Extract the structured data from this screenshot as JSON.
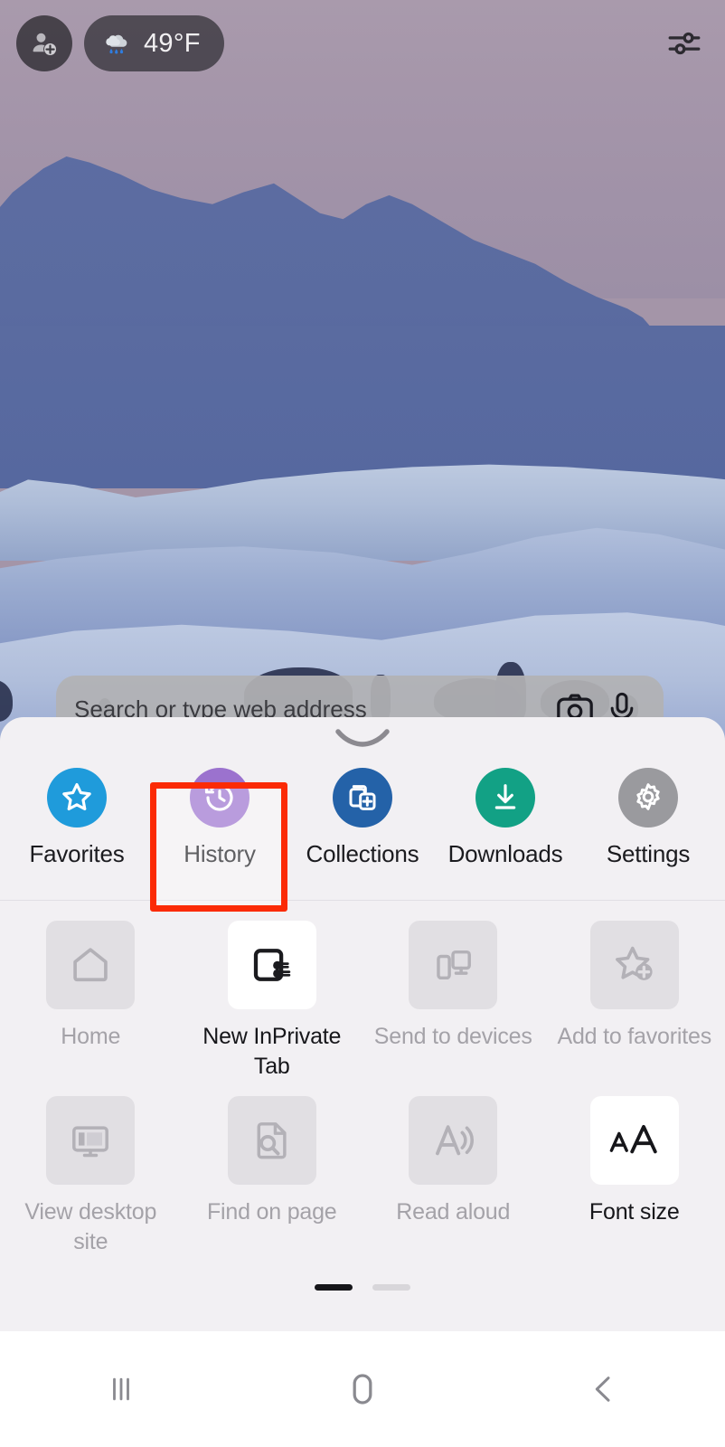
{
  "statusbar": {
    "profile_icon": "person-add-icon",
    "weather": {
      "icon": "rain-cloud-icon",
      "glyph": "🌧",
      "temperature": "49°F"
    },
    "customize_icon": "sliders-icon"
  },
  "addressbar": {
    "placeholder": "Search or type web address",
    "camera_icon": "camera-icon",
    "mic_icon": "microphone-icon"
  },
  "sheet": {
    "handle_icon": "drag-handle-chevron-icon",
    "quick_actions": [
      {
        "label": "Favorites",
        "icon": "star-icon",
        "color": "#1f9bdb",
        "highlighted": false
      },
      {
        "label": "History",
        "icon": "history-clock-icon",
        "color": "#9b72ce",
        "highlighted": true
      },
      {
        "label": "Collections",
        "icon": "collections-add-icon",
        "color": "#2462a8",
        "highlighted": false
      },
      {
        "label": "Downloads",
        "icon": "download-arrow-icon",
        "color": "#12a185",
        "highlighted": false
      },
      {
        "label": "Settings",
        "icon": "gear-icon",
        "color": "#9a9a9e",
        "highlighted": false
      }
    ],
    "highlight_color": "#fb2b06",
    "grid_rows": [
      [
        {
          "label": "Home",
          "icon": "home-icon",
          "enabled": false
        },
        {
          "label": "New InPrivate Tab",
          "icon": "inprivate-tab-icon",
          "enabled": true
        },
        {
          "label": "Send to devices",
          "icon": "send-to-devices-icon",
          "enabled": false
        },
        {
          "label": "Add to favorites",
          "icon": "star-add-icon",
          "enabled": false
        }
      ],
      [
        {
          "label": "View desktop site",
          "icon": "desktop-monitor-icon",
          "enabled": false
        },
        {
          "label": "Find on page",
          "icon": "find-page-icon",
          "enabled": false
        },
        {
          "label": "Read aloud",
          "icon": "read-aloud-icon",
          "enabled": false
        },
        {
          "label": "Font size",
          "icon": "font-size-icon",
          "enabled": true
        }
      ]
    ],
    "pager": {
      "pages": 2,
      "active_index": 0
    }
  },
  "navbar": {
    "recents_icon": "recents-icon",
    "home_icon": "home-pill-icon",
    "back_icon": "back-chevron-icon"
  }
}
